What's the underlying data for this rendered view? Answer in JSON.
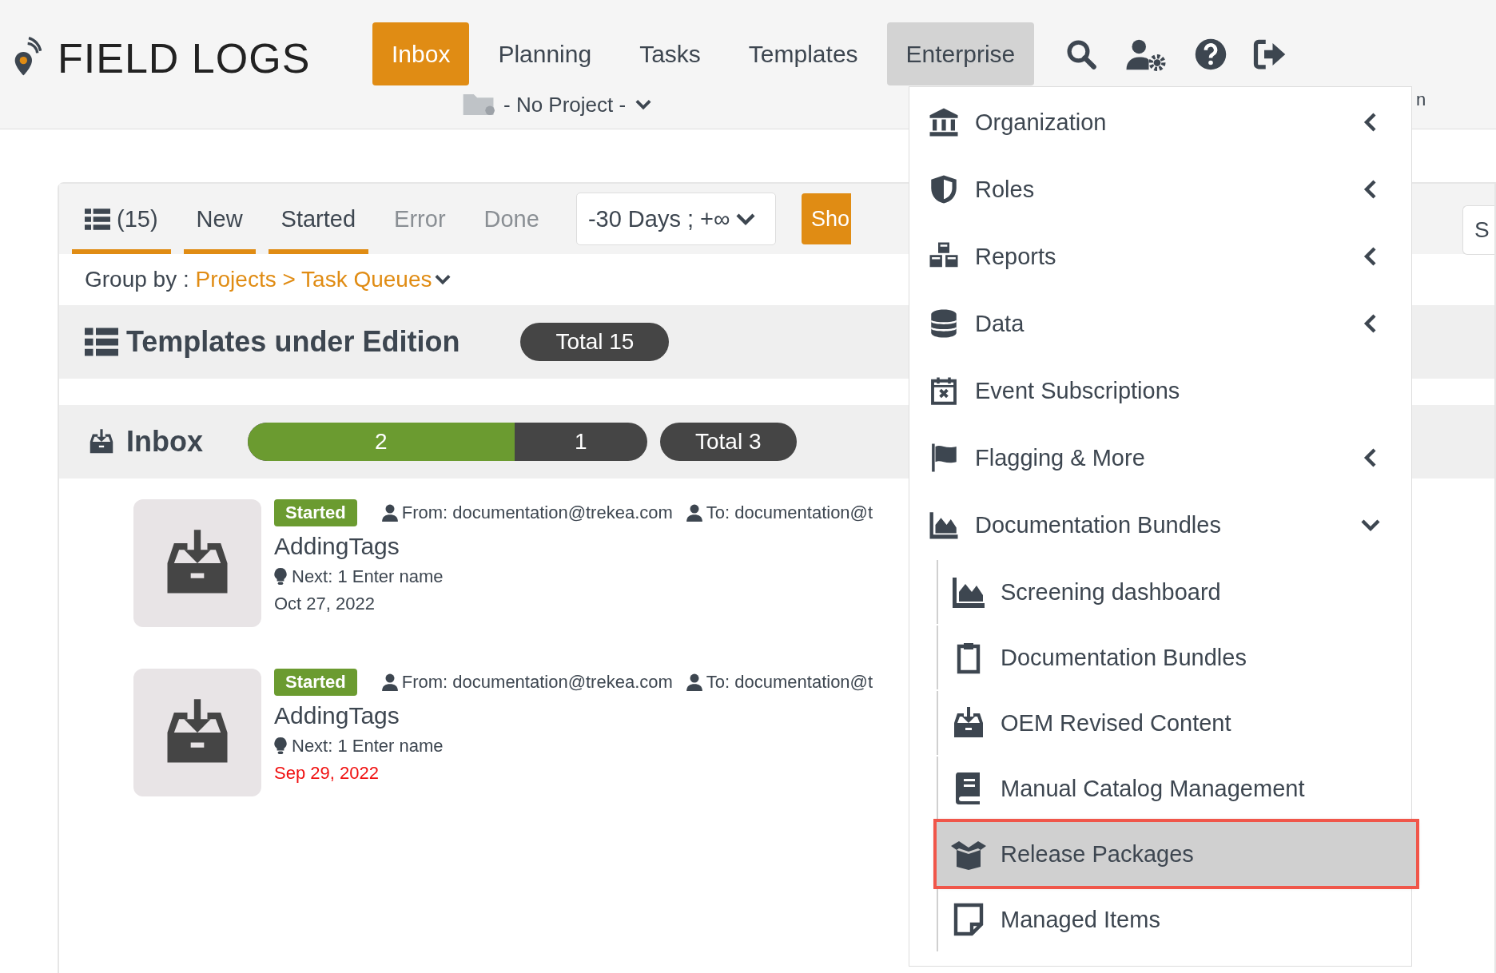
{
  "logo": {
    "text": "FIELD LOGS"
  },
  "nav": [
    {
      "label": "Inbox",
      "selected": true,
      "open": false
    },
    {
      "label": "Planning",
      "selected": false,
      "open": false
    },
    {
      "label": "Tasks",
      "selected": false,
      "open": false
    },
    {
      "label": "Templates",
      "selected": false,
      "open": false
    },
    {
      "label": "Enterprise",
      "selected": false,
      "open": true
    }
  ],
  "project_selector": {
    "value": "- No Project -"
  },
  "header_fragment": "n",
  "tabs": [
    {
      "label": "(15)",
      "kind": "all",
      "active": true
    },
    {
      "label": "New",
      "kind": "state",
      "active": true
    },
    {
      "label": "Started",
      "kind": "state",
      "active": true
    },
    {
      "label": "Error",
      "kind": "state",
      "active": false
    },
    {
      "label": "Done",
      "kind": "state",
      "active": false
    }
  ],
  "date_filter": {
    "value": "-30 Days ; +∞"
  },
  "show_button": {
    "label": "Sho"
  },
  "right_field": {
    "value": "S"
  },
  "group_by": {
    "label": "Group by :",
    "value": "Projects > Task Queues"
  },
  "sections": [
    {
      "kind": "templates",
      "title": "Templates under Edition",
      "total": "Total 15"
    },
    {
      "kind": "inbox",
      "title": "Inbox",
      "progress": {
        "level": 0.667,
        "done": "2",
        "remaining": "1"
      },
      "total": "Total 3",
      "items": [
        {
          "status": "Started",
          "from": "From: documentation@trekea.com",
          "to": "To: documentation@t",
          "title": "AddingTags",
          "next": "Next: 1 Enter name",
          "date": "Oct 27, 2022",
          "overdue": false
        },
        {
          "status": "Started",
          "from": "From: documentation@trekea.com",
          "to": "To: documentation@t",
          "title": "AddingTags",
          "next": "Next: 1 Enter name",
          "date": "Sep 29, 2022",
          "overdue": true
        }
      ]
    }
  ],
  "menu": {
    "items": [
      {
        "label": "Organization",
        "kind": "submenu",
        "expanded": false
      },
      {
        "label": "Roles",
        "kind": "submenu",
        "expanded": false
      },
      {
        "label": "Reports",
        "kind": "submenu",
        "expanded": false
      },
      {
        "label": "Data",
        "kind": "submenu",
        "expanded": false
      },
      {
        "label": "Event Subscriptions",
        "kind": "link"
      },
      {
        "label": "Flagging & More",
        "kind": "submenu",
        "expanded": false
      },
      {
        "label": "Documentation Bundles",
        "kind": "submenu",
        "expanded": true,
        "children": [
          {
            "label": "Screening dashboard",
            "selected": false
          },
          {
            "label": "Documentation Bundles",
            "selected": false
          },
          {
            "label": "OEM Revised Content",
            "selected": false
          },
          {
            "label": "Manual Catalog Management",
            "selected": false
          },
          {
            "label": "Release Packages",
            "selected": true
          },
          {
            "label": "Managed Items",
            "selected": false
          }
        ]
      }
    ]
  }
}
